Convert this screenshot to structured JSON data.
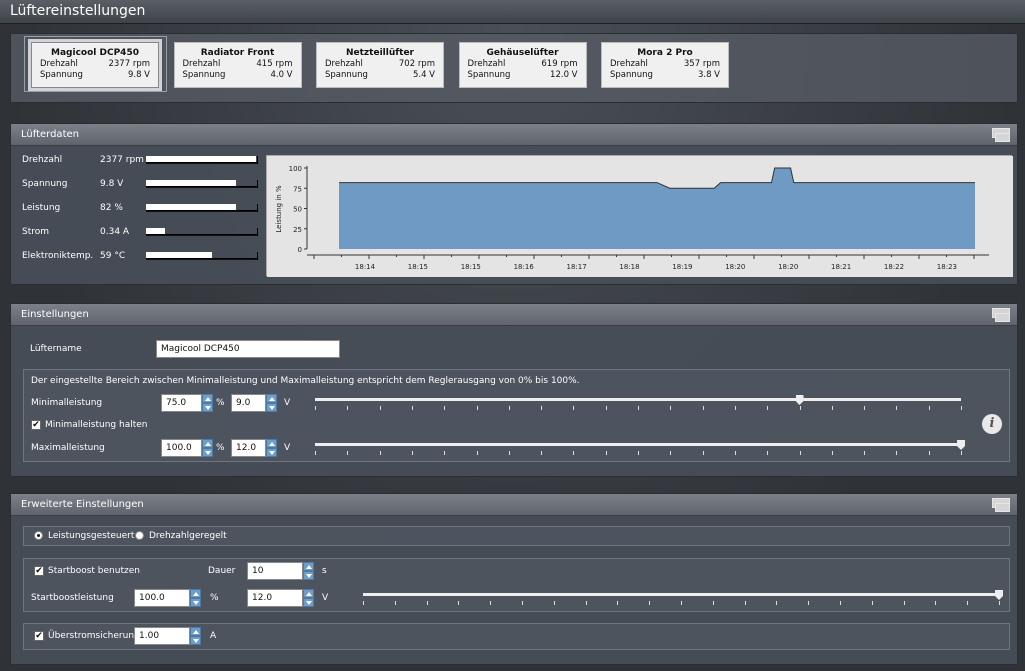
{
  "window": {
    "title": "Lüftereinstellungen"
  },
  "fans": [
    {
      "name": "Magicool DCP450",
      "rpm_label": "Drehzahl",
      "rpm": "2377 rpm",
      "volt_label": "Spannung",
      "volt": "9.8 V"
    },
    {
      "name": "Radiator Front",
      "rpm_label": "Drehzahl",
      "rpm": "415 rpm",
      "volt_label": "Spannung",
      "volt": "4.0 V"
    },
    {
      "name": "Netzteillüfter",
      "rpm_label": "Drehzahl",
      "rpm": "702 rpm",
      "volt_label": "Spannung",
      "volt": "5.4 V"
    },
    {
      "name": "Gehäuselüfter",
      "rpm_label": "Drehzahl",
      "rpm": "619 rpm",
      "volt_label": "Spannung",
      "volt": "12.0 V"
    },
    {
      "name": "Mora 2 Pro",
      "rpm_label": "Drehzahl",
      "rpm": "357 rpm",
      "volt_label": "Spannung",
      "volt": "3.8 V"
    }
  ],
  "fandata": {
    "title": "Lüfterdaten",
    "rows": [
      {
        "label": "Drehzahl",
        "value": "2377 rpm",
        "fill": 1.0
      },
      {
        "label": "Spannung",
        "value": "9.8 V",
        "fill": 0.82
      },
      {
        "label": "Leistung",
        "value": "82 %",
        "fill": 0.82
      },
      {
        "label": "Strom",
        "value": "0.34 A",
        "fill": 0.17
      },
      {
        "label": "Elektroniktemp.",
        "value": "59 °C",
        "fill": 0.6
      }
    ]
  },
  "chart_data": {
    "type": "area",
    "ylabel": "Leistung in %",
    "ylim": [
      0,
      100
    ],
    "yticks": [
      "100",
      "75",
      "50",
      "25",
      "0"
    ],
    "xticks": [
      "18:14",
      "18:15",
      "18:15",
      "18:16",
      "18:17",
      "18:18",
      "18:19",
      "18:20",
      "18:20",
      "18:21",
      "18:22",
      "18:23"
    ],
    "series": [
      {
        "points": [
          [
            0,
            82
          ],
          [
            0.5,
            82
          ],
          [
            0.52,
            75
          ],
          [
            0.59,
            75
          ],
          [
            0.6,
            82
          ],
          [
            0.68,
            82
          ],
          [
            0.685,
            100
          ],
          [
            0.71,
            100
          ],
          [
            0.715,
            82
          ],
          [
            1,
            82
          ]
        ]
      }
    ],
    "color": "#6e9ac3"
  },
  "settings": {
    "title": "Einstellungen",
    "name_label": "Lüftername",
    "name_value": "Magicool DCP450",
    "range_note": "Der eingestellte Bereich zwischen Minimalleistung und Maximalleistung entspricht dem Reglerausgang von 0% bis 100%.",
    "min_label": "Minimalleistung",
    "min_pct": "75.0",
    "pct_unit": "%",
    "min_volt": "9.0",
    "volt_unit": "V",
    "min_slider": 0.75,
    "hold_label": "Minimalleistung halten",
    "max_label": "Maximalleistung",
    "max_pct": "100.0",
    "max_volt": "12.0",
    "max_slider": 1.0,
    "info_icon": "i"
  },
  "advanced": {
    "title": "Erweiterte Einstellungen",
    "mode_power": "Leistungsgesteuert",
    "mode_rpm": "Drehzahlgeregelt",
    "boost_label": "Startboost benutzen",
    "duration_label": "Dauer",
    "duration_value": "10",
    "duration_unit": "s",
    "boost_power_label": "Startboostleistung",
    "boost_pct": "100.0",
    "pct_unit": "%",
    "boost_volt": "12.0",
    "volt_unit": "V",
    "boost_slider": 1.0,
    "overcurrent_label": "Überstromsicherung",
    "overcurrent_value": "1.00",
    "overcurrent_unit": "A"
  },
  "check_mark": "✔"
}
